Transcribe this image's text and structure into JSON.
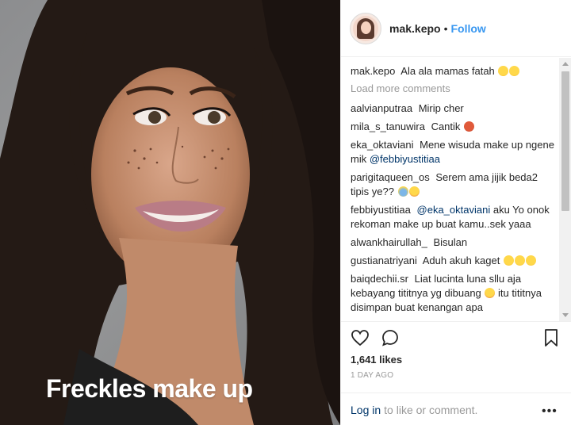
{
  "photo": {
    "caption": "Freckles make up"
  },
  "header": {
    "username": "mak.kepo",
    "separator": "•",
    "follow_label": "Follow"
  },
  "caption": {
    "username": "mak.kepo",
    "text": "Ala ala mamas fatah"
  },
  "load_more_label": "Load more comments",
  "comments": [
    {
      "user": "aalvianputraa",
      "text": "Mirip cher"
    },
    {
      "user": "mila_s_tanuwira",
      "text": "Cantik"
    },
    {
      "user": "eka_oktaviani",
      "text": "Mene wisuda make up ngene mik",
      "mention": "@febbiyustitiaa"
    },
    {
      "user": "parigitaqueen_os",
      "text": "Serem ama jijik beda2 tipis ye??"
    },
    {
      "user": "febbiyustitiaa",
      "mention": "@eka_oktaviani",
      "text": "aku Yo onok rekoman make up buat kamu..sek yaaa"
    },
    {
      "user": "alwankhairullah_",
      "text": "Bisulan"
    },
    {
      "user": "gustianatriyani",
      "text": "Aduh akuh kaget"
    },
    {
      "user": "baiqdechii.sr",
      "text": "Liat lucinta luna sllu aja kebayang tititnya yg dibuang",
      "text2": "itu tititnya disimpan buat kenangan apa"
    }
  ],
  "actions": {
    "like_icon": "heart-icon",
    "comment_icon": "comment-bubble-icon",
    "save_icon": "bookmark-icon"
  },
  "likes": "1,641 likes",
  "timestamp": "1 DAY AGO",
  "footer": {
    "login_label": "Log in",
    "rest": "to like or comment.",
    "more": "•••"
  },
  "colors": {
    "link": "#3897f0",
    "mention": "#003569",
    "muted": "#999999"
  }
}
